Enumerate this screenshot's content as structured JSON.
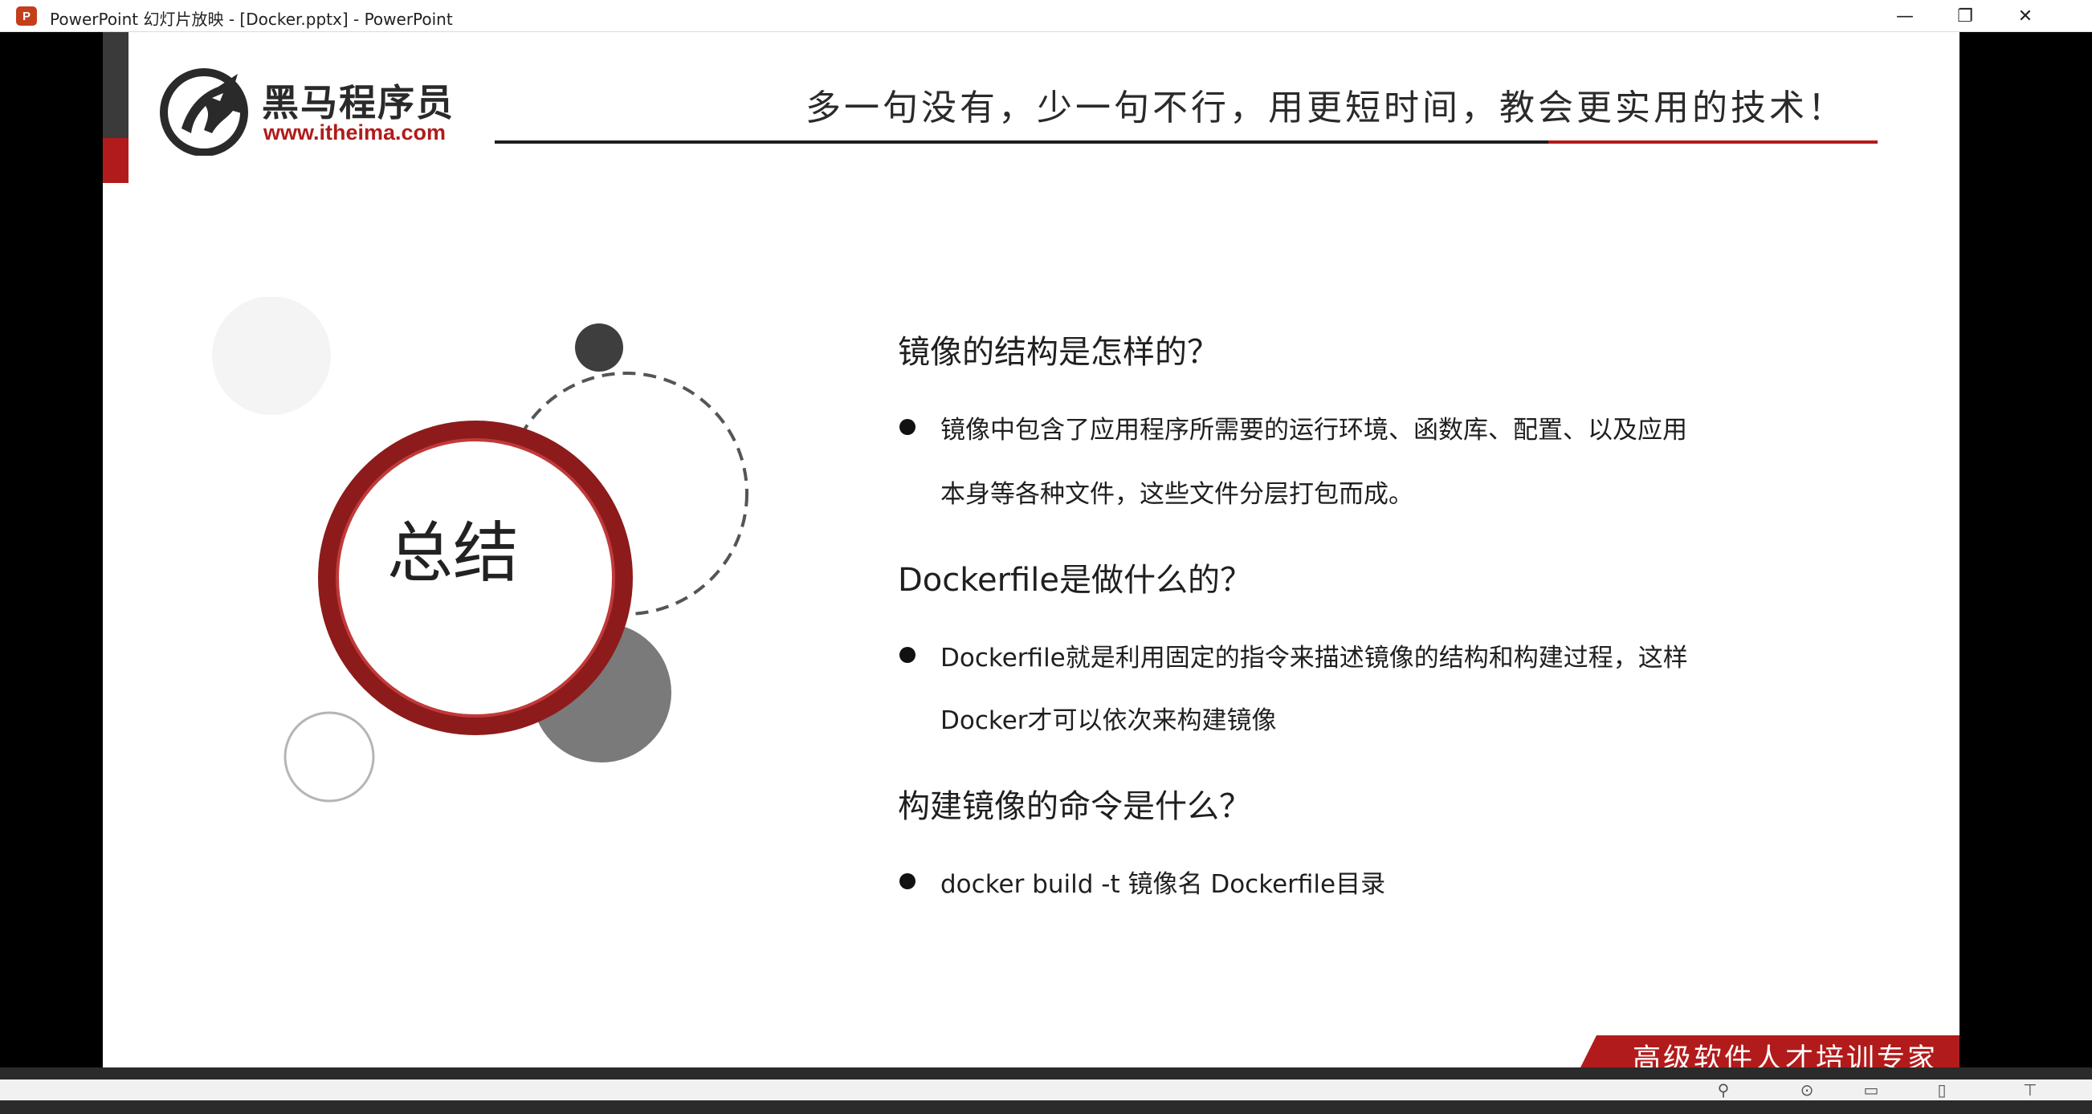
{
  "window": {
    "app_icon": "P",
    "title": "PowerPoint 幻灯片放映 - [Docker.pptx] - PowerPoint",
    "minimize_glyph": "—",
    "maximize_glyph": "❐",
    "close_glyph": "✕"
  },
  "slide": {
    "logo": {
      "name": "黑马程序员",
      "url": "www.itheima.com"
    },
    "slogan": "多一句没有，少一句不行，用更短时间，教会更实用的技术！",
    "summary_title": "总结",
    "qa": [
      {
        "question": "镜像的结构是怎样的？",
        "answer_lines": [
          "镜像中包含了应用程序所需要的运行环境、函数库、配置、以及应用",
          "本身等各种文件，这些文件分层打包而成。"
        ]
      },
      {
        "question": "Dockerfile是做什么的？",
        "answer_lines": [
          "Dockerfile就是利用固定的指令来描述镜像的结构和构建过程，这样",
          "Docker才可以依次来构建镜像"
        ]
      },
      {
        "question": "构建镜像的命令是什么？",
        "answer_lines": [
          "docker build -t 镜像名 Dockerfile目录"
        ]
      }
    ],
    "footer_tagline": "高级软件人才培训专家"
  },
  "slideshow_controls": [
    {
      "name": "search-icon",
      "glyph": "⚲"
    },
    {
      "name": "camera-icon",
      "glyph": "⊙"
    },
    {
      "name": "normal-view-icon",
      "glyph": "▭"
    },
    {
      "name": "reading-view-icon",
      "glyph": "▯"
    },
    {
      "name": "slideshow-icon",
      "glyph": "⊤"
    }
  ],
  "colors": {
    "brand_red": "#b21b1b",
    "dark": "#2a2a2a",
    "gray_circle": "#7a7a7a"
  }
}
